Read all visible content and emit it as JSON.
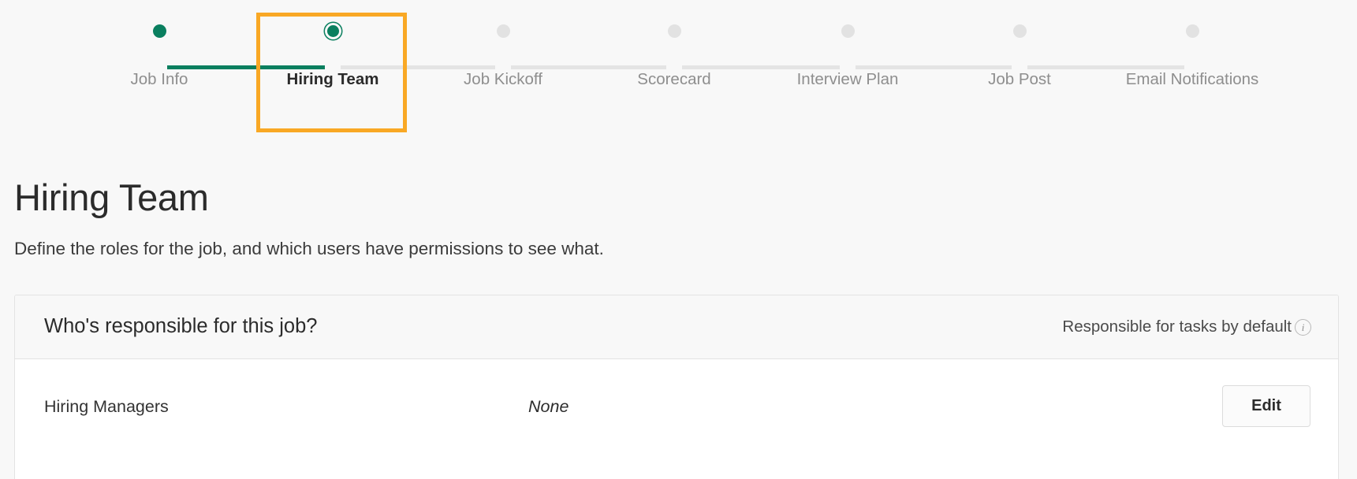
{
  "stepper": {
    "steps": [
      {
        "label": "Job Info",
        "state": "done"
      },
      {
        "label": "Hiring Team",
        "state": "active"
      },
      {
        "label": "Job Kickoff",
        "state": "upcoming"
      },
      {
        "label": "Scorecard",
        "state": "upcoming"
      },
      {
        "label": "Interview Plan",
        "state": "upcoming"
      },
      {
        "label": "Job Post",
        "state": "upcoming"
      },
      {
        "label": "Email Notifications",
        "state": "upcoming"
      }
    ],
    "highlighted_step": "Hiring Team",
    "colors": {
      "completed": "#0a7f5f",
      "upcoming": "#e2e2e2",
      "highlight": "#f9a825"
    }
  },
  "page": {
    "title": "Hiring Team",
    "subtitle": "Define the roles for the job, and which users have permissions to see what."
  },
  "card": {
    "header_title": "Who's responsible for this job?",
    "header_note": "Responsible for tasks by default",
    "info_icon_glyph": "i",
    "rows": [
      {
        "role": "Hiring Managers",
        "value": "None",
        "action_label": "Edit"
      }
    ]
  }
}
